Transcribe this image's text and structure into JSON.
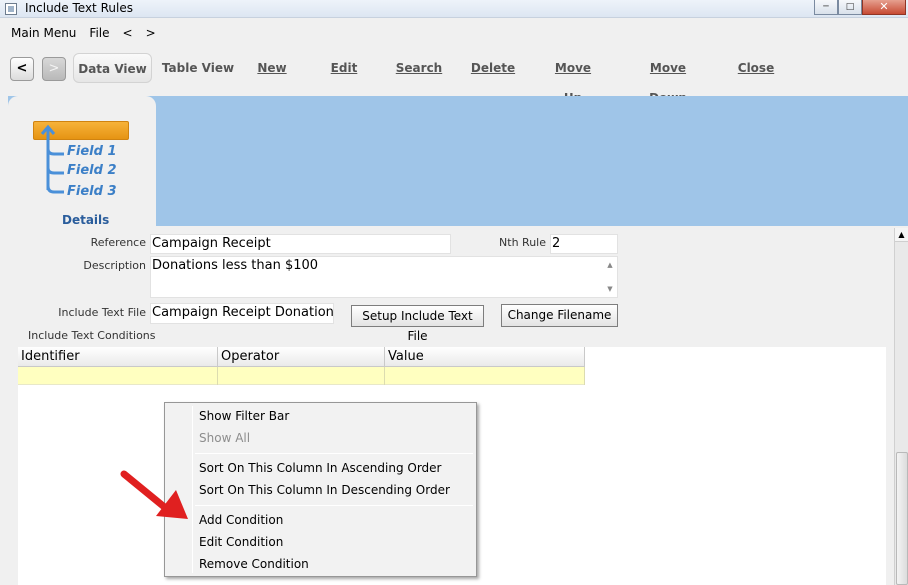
{
  "window": {
    "title": "Include Text Rules"
  },
  "menubar": {
    "items": [
      "Main Menu",
      "File",
      "<",
      ">"
    ]
  },
  "toolbar": {
    "prev_label": "<",
    "next_label": ">",
    "data_view": "Data View",
    "table_view": "Table View",
    "new": "New",
    "edit": "Edit",
    "search": "Search",
    "delete": "Delete",
    "move_up": "Move Up",
    "move_down": "Move Down",
    "close": "Close"
  },
  "tab": {
    "label": "Details",
    "fields": [
      "Field 1",
      "Field 2",
      "Field 3"
    ]
  },
  "form": {
    "reference_label": "Reference",
    "reference_value": "Campaign Receipt",
    "nth_rule_label": "Nth Rule",
    "nth_rule_value": "2",
    "description_label": "Description",
    "description_value": "Donations less than $100",
    "include_file_label": "Include Text File",
    "include_file_value": "Campaign Receipt Donations le",
    "setup_button": "Setup Include Text File",
    "change_button": "Change Filename",
    "conditions_label": "Include Text Conditions"
  },
  "grid": {
    "columns": [
      "Identifier",
      "Operator",
      "Value"
    ]
  },
  "context_menu": {
    "show_filter_bar": "Show Filter Bar",
    "show_all": "Show All",
    "sort_asc": "Sort On This Column In Ascending Order",
    "sort_desc": "Sort On This Column In Descending Order",
    "add_condition": "Add Condition",
    "edit_condition": "Edit Condition",
    "remove_condition": "Remove Condition"
  },
  "colors": {
    "header_blue": "#9fc5e8",
    "orange": "#f0a020",
    "row_highlight": "#ffffc0",
    "arrow_red": "#e02020",
    "tab_label": "#2a5d9c"
  }
}
